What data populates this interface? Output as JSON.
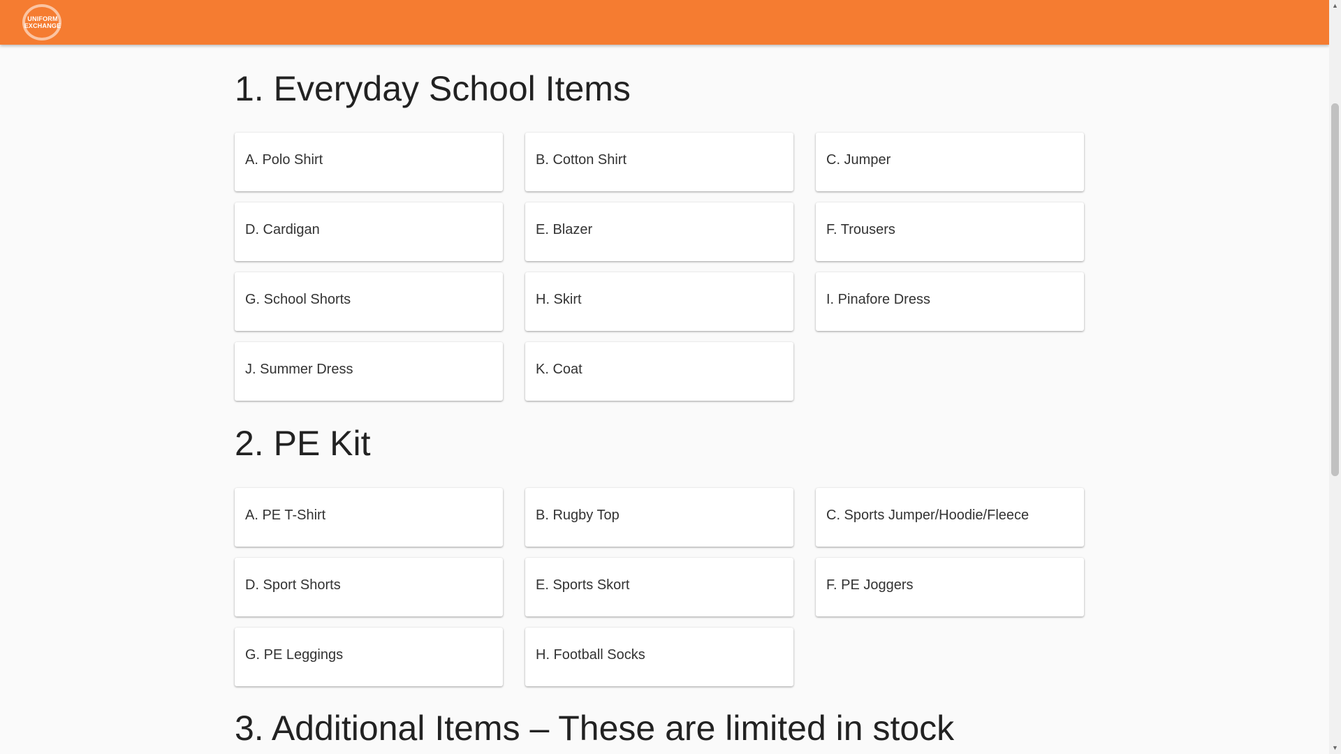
{
  "header": {
    "logo_line1": "UNIFORM",
    "logo_line2": "EXCHANGE",
    "brand_color": "#f57c31"
  },
  "sections": [
    {
      "title": "1. Everyday School Items",
      "items": [
        "A. Polo Shirt",
        "B. Cotton Shirt",
        "C. Jumper",
        "D. Cardigan",
        "E. Blazer",
        "F. Trousers",
        "G. School Shorts",
        "H. Skirt",
        "I. Pinafore Dress",
        "J. Summer Dress",
        "K. Coat"
      ]
    },
    {
      "title": "2. PE Kit",
      "items": [
        "A. PE T-Shirt",
        "B. Rugby Top",
        "C. Sports Jumper/Hoodie/Fleece",
        "D. Sport Shorts",
        "E. Sports Skort",
        "F. PE Joggers",
        "G. PE Leggings",
        "H. Football Socks"
      ]
    },
    {
      "title": "3. Additional Items – These are limited in stock",
      "items": []
    }
  ],
  "scrollbar": {
    "up_icon": "scroll-up-arrow-icon",
    "down_icon": "scroll-down-arrow-icon"
  }
}
